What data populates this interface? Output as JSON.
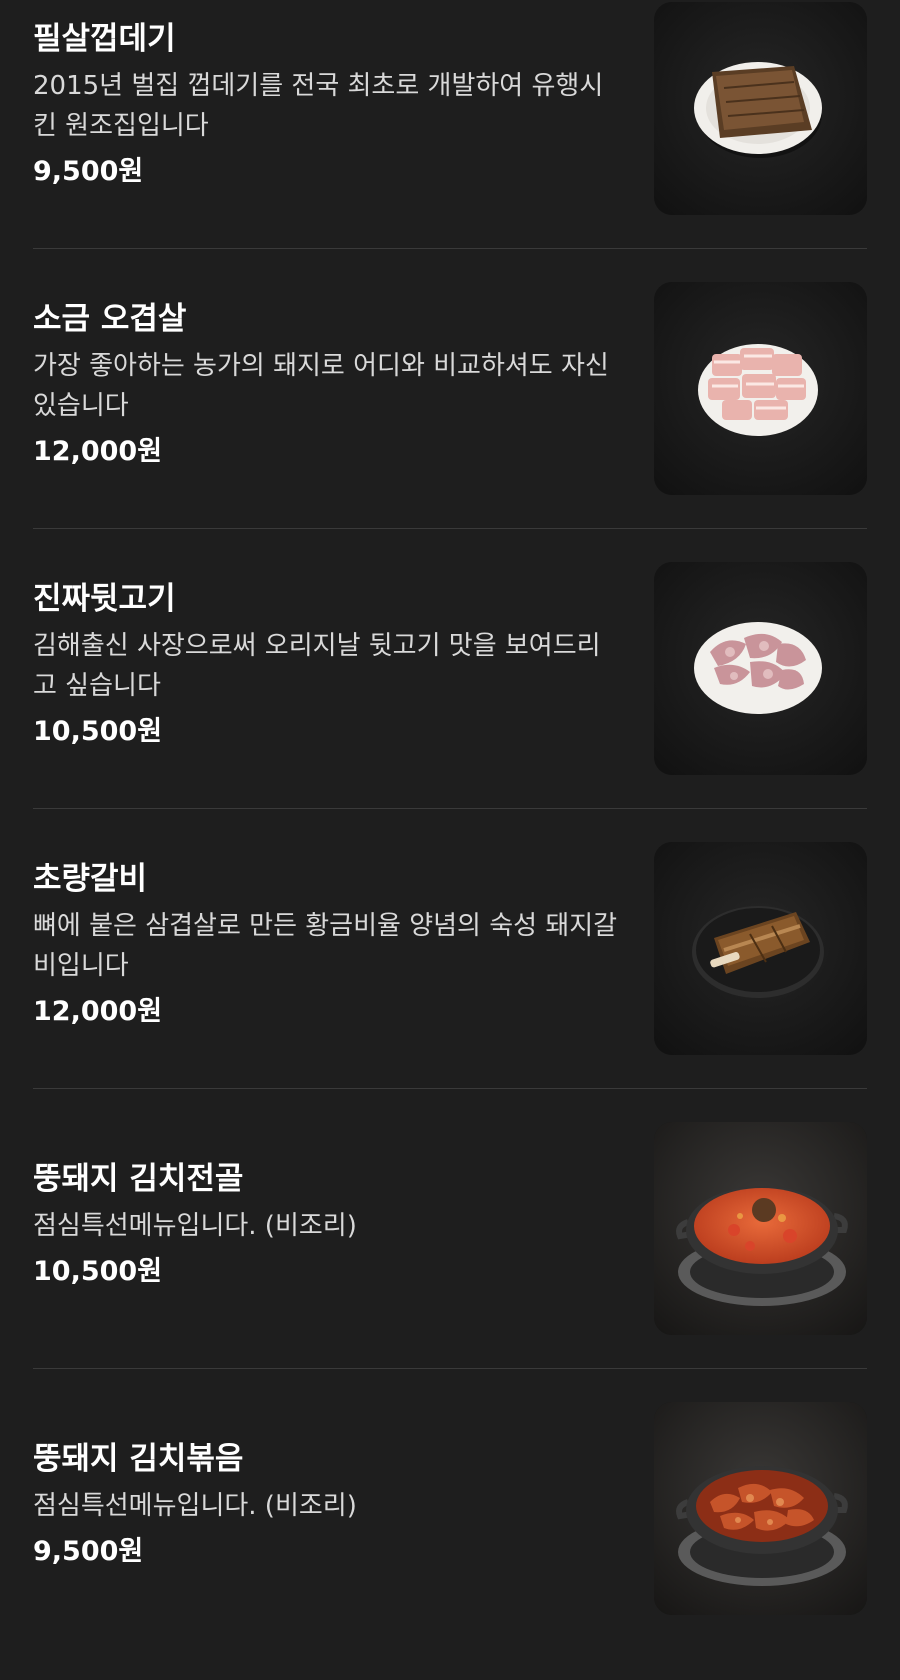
{
  "menu": {
    "items": [
      {
        "name": "필살껍데기",
        "desc": "2015년 벌집 껍데기를 전국 최초로 개발하여 유행시킨 원조집입니다",
        "price": "9,500원",
        "image_icon": "pork-skin-plate-image"
      },
      {
        "name": "소금 오겹살",
        "desc": "가장 좋아하는 농가의 돼지로 어디와 비교하셔도 자신 있습니다",
        "price": "12,000원",
        "image_icon": "pork-belly-plate-image"
      },
      {
        "name": "진짜뒷고기",
        "desc": "김해출신 사장으로써 오리지날 뒷고기 맛을 보여드리고 싶습니다",
        "price": "10,500원",
        "image_icon": "pork-trimmings-plate-image"
      },
      {
        "name": "초량갈비",
        "desc": "뼈에 붙은 삼겹살로 만든 황금비율 양념의 숙성 돼지갈비입니다",
        "price": "12,000원",
        "image_icon": "marinated-ribs-plate-image"
      },
      {
        "name": "뚱돼지 김치전골",
        "desc": "점심특선메뉴입니다. (비조리)",
        "price": "10,500원",
        "image_icon": "kimchi-stew-pot-image"
      },
      {
        "name": "뚱돼지 김치볶음",
        "desc": "점심특선메뉴입니다. (비조리)",
        "price": "9,500원",
        "image_icon": "kimchi-stirfry-pan-image"
      }
    ]
  }
}
